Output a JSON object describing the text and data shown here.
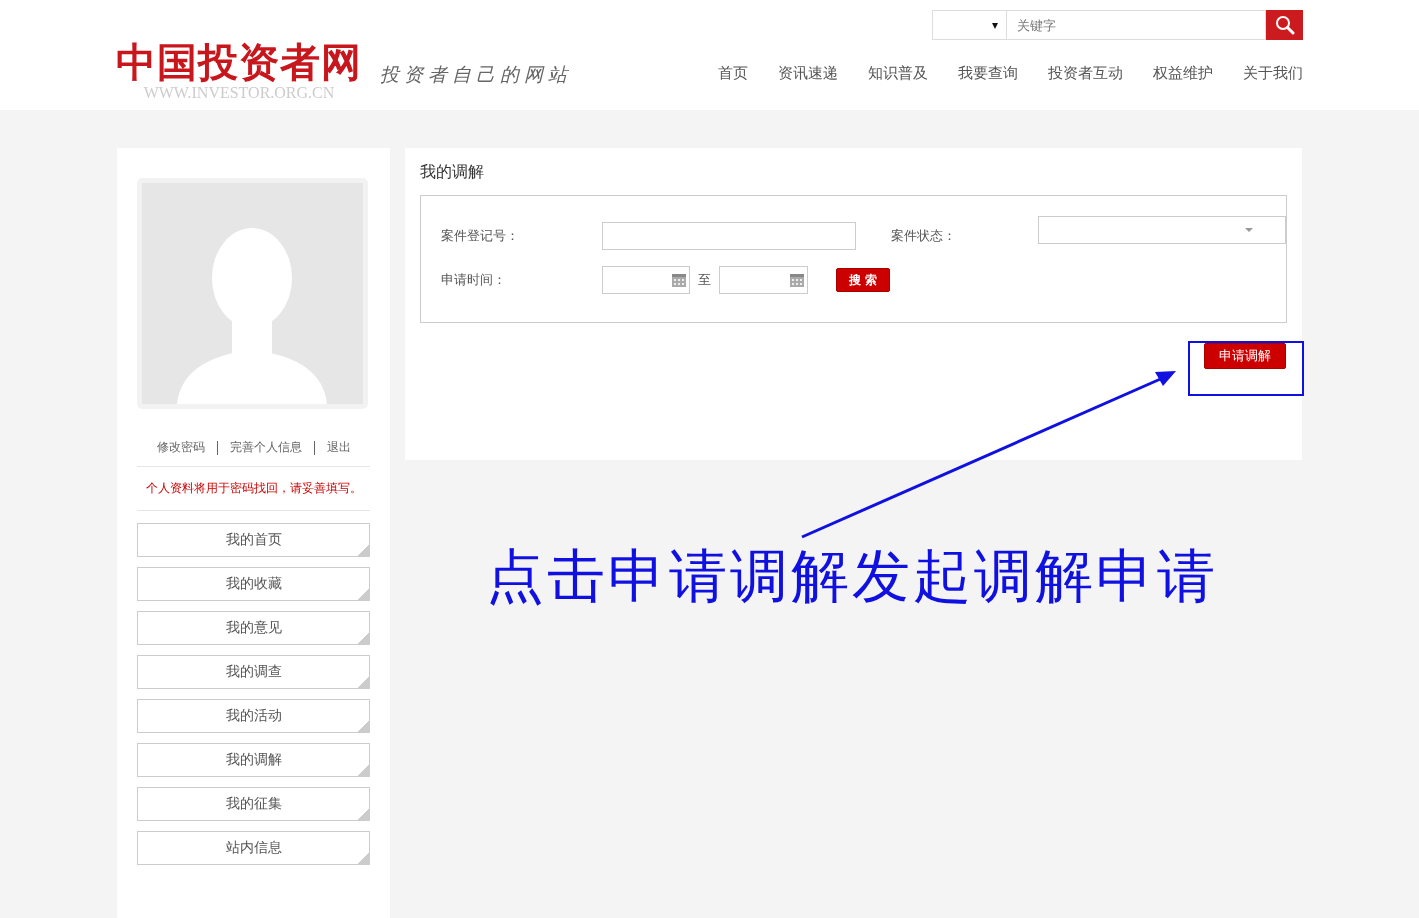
{
  "header": {
    "logo": "中国投资者网",
    "logo_url": "WWW.INVESTOR.ORG.CN",
    "slogan": "投资者自己的网站",
    "search": {
      "category_caret": "▾",
      "placeholder": "关键字"
    },
    "nav": [
      "首页",
      "资讯速递",
      "知识普及",
      "我要查询",
      "投资者互动",
      "权益维护",
      "关于我们"
    ]
  },
  "sidebar": {
    "links": [
      "修改密码",
      "完善个人信息",
      "退出"
    ],
    "notice": "个人资料将用于密码找回，请妥善填写。",
    "menu": [
      "我的首页",
      "我的收藏",
      "我的意见",
      "我的调查",
      "我的活动",
      "我的调解",
      "我的征集",
      "站内信息"
    ]
  },
  "main": {
    "title": "我的调解",
    "filters": {
      "case_no_label": "案件登记号：",
      "status_label": "案件状态：",
      "date_label": "申请时间：",
      "date_sep": "至",
      "search_button": "搜 索"
    },
    "apply_button": "申请调解"
  },
  "annotation": {
    "text": "点击申请调解发起调解申请"
  }
}
